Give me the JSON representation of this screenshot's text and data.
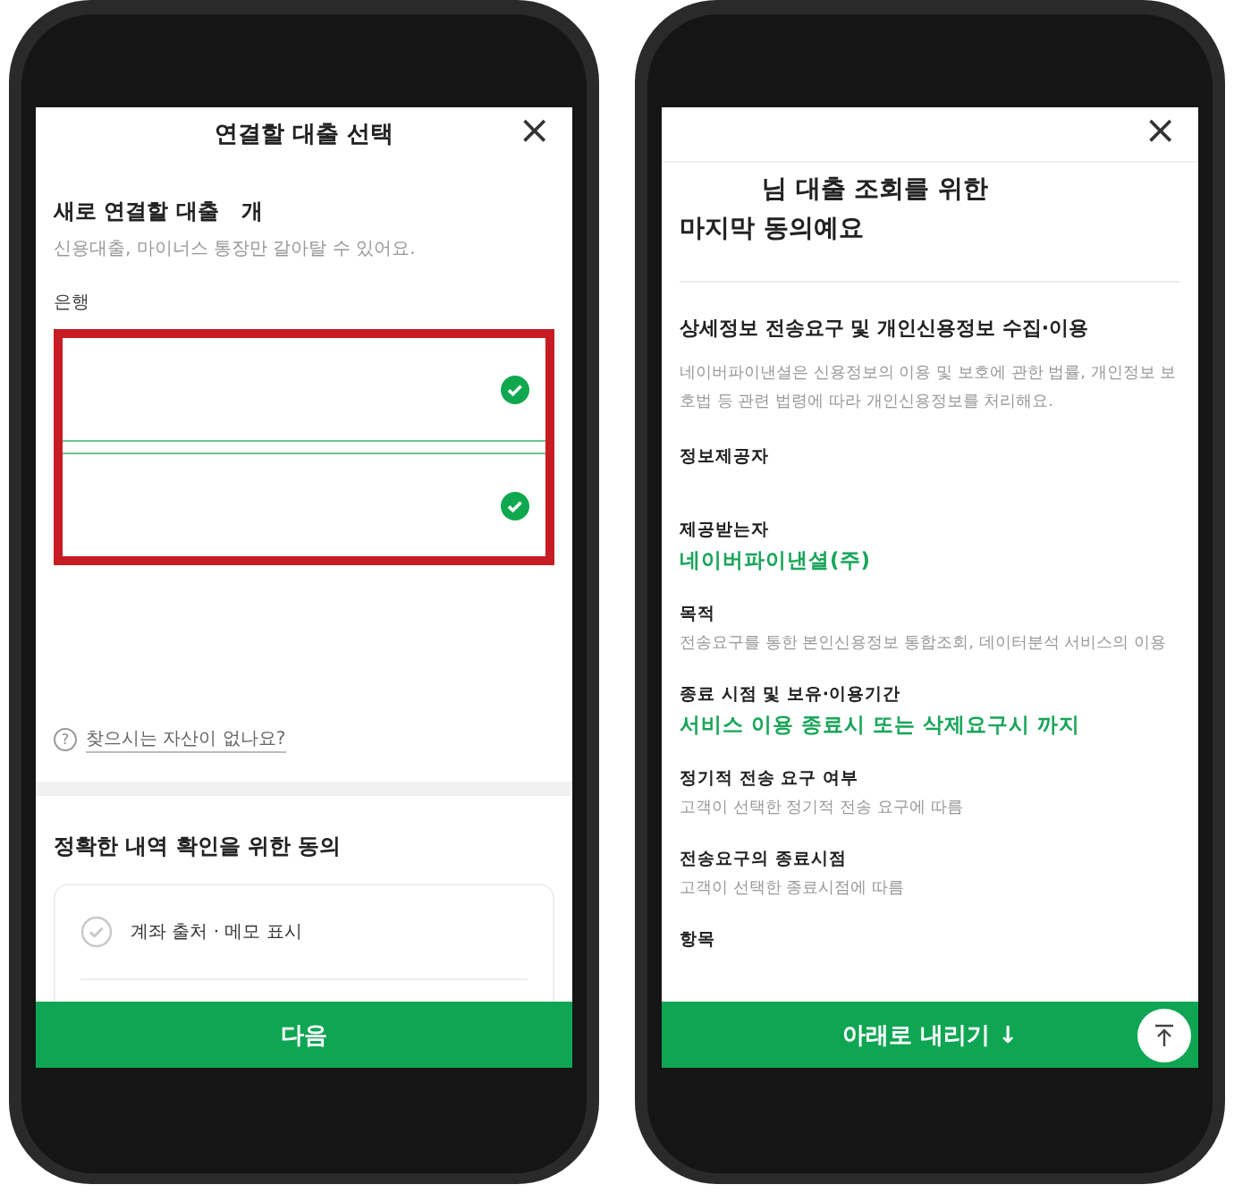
{
  "left_screen": {
    "title": "연결할 대출 선택",
    "close": "×",
    "new_loans_label": "새로 연결할 대출   개",
    "new_loans_hint": "신용대출, 마이너스 통장만 갈아탈 수 있어요.",
    "bank_label": "은행",
    "banks": [
      {
        "checked": true
      },
      {
        "checked": true
      }
    ],
    "help_icon": "?",
    "help_link": "찾으시는 자산이 없나요?",
    "consent_title": "정확한 내역 확인을 위한 동의",
    "consent_items": [
      {
        "label": "계좌 출처 · 메모 표시",
        "checked": false
      }
    ],
    "next_button": "다음"
  },
  "right_screen": {
    "close": "×",
    "heading_line_1": "님 대출 조회를 위한",
    "heading_line_2": "마지막 동의예요",
    "section_title": "상세정보 전송요구 및 개인신용정보 수집·이용",
    "intro": "네이버파이낸셜은 신용정보의 이용 및 보호에 관한 법률, 개인정보 보호법 등 관련 법령에 따라 개인신용정보를 처리해요.",
    "fields": [
      {
        "label": "정보제공자"
      },
      {
        "label": "제공받는자",
        "value": "네이버파이낸셜(주)",
        "kind": "highlight"
      },
      {
        "label": "목적",
        "value": "전송요구를 통한 본인신용정보 통합조회, 데이터분석 서비스의 이용",
        "kind": "plain"
      },
      {
        "label": "종료 시점 및 보유·이용기간",
        "value": "서비스 이용 종료시 또는 삭제요구시 까지",
        "kind": "highlight"
      },
      {
        "label": "정기적 전송 요구 여부",
        "value": "고객이 선택한 정기적 전송 요구에 따름",
        "kind": "plain"
      },
      {
        "label": "전송요구의 종료시점",
        "value": "고객이 선택한 종료시점에 따름",
        "kind": "plain"
      },
      {
        "label": "항목"
      }
    ],
    "scroll_button": "아래로 내리기 ↓"
  }
}
